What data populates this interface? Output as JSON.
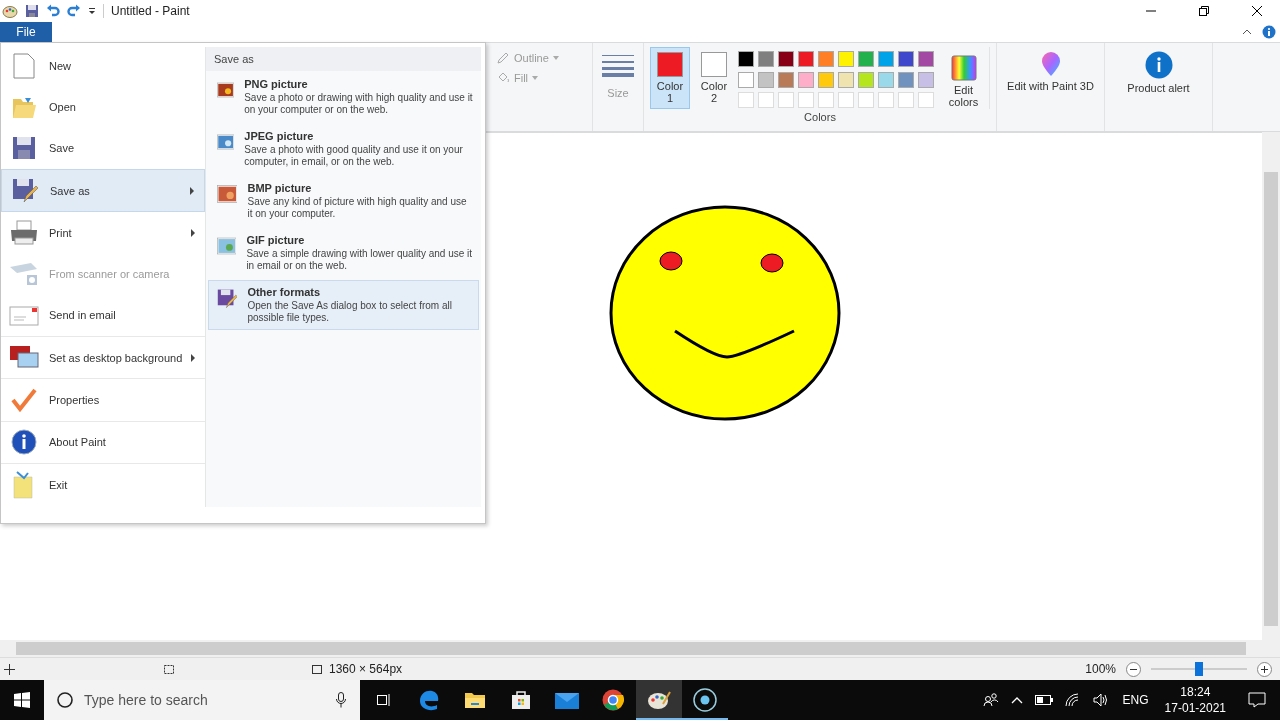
{
  "window": {
    "title": "Untitled - Paint"
  },
  "file_tab": {
    "label": "File",
    "selected": true
  },
  "file_menu": {
    "items": [
      {
        "label": "New",
        "disabled": false,
        "selected": false,
        "has_submenu": false
      },
      {
        "label": "Open",
        "disabled": false,
        "selected": false,
        "has_submenu": false
      },
      {
        "label": "Save",
        "disabled": false,
        "selected": false,
        "has_submenu": false
      },
      {
        "label": "Save as",
        "disabled": false,
        "selected": true,
        "has_submenu": true
      },
      {
        "label": "Print",
        "disabled": false,
        "selected": false,
        "has_submenu": true
      },
      {
        "label": "From scanner or camera",
        "disabled": true,
        "selected": false,
        "has_submenu": false
      },
      {
        "label": "Send in email",
        "disabled": false,
        "selected": false,
        "has_submenu": false
      },
      {
        "label": "Set as desktop background",
        "disabled": false,
        "selected": false,
        "has_submenu": true
      },
      {
        "label": "Properties",
        "disabled": false,
        "selected": false,
        "has_submenu": false
      },
      {
        "label": "About Paint",
        "disabled": false,
        "selected": false,
        "has_submenu": false
      },
      {
        "label": "Exit",
        "disabled": false,
        "selected": false,
        "has_submenu": false
      }
    ],
    "submenu": {
      "heading": "Save as",
      "options": [
        {
          "title": "PNG picture",
          "description": "Save a photo or drawing with high quality and use it on your computer or on the web.",
          "selected": false
        },
        {
          "title": "JPEG picture",
          "description": "Save a photo with good quality and use it on your computer, in email, or on the web.",
          "selected": false
        },
        {
          "title": "BMP picture",
          "description": "Save any kind of picture with high quality and use it on your computer.",
          "selected": false
        },
        {
          "title": "GIF picture",
          "description": "Save a simple drawing with lower quality and use it in email or on the web.",
          "selected": false
        },
        {
          "title": "Other formats",
          "description": "Open the Save As dialog box to select from all possible file types.",
          "selected": true
        }
      ]
    }
  },
  "ribbon": {
    "outline": "Outline",
    "fill": "Fill",
    "size": "Size",
    "color_slots": [
      {
        "label": "Color 1",
        "color": "#ed1c24",
        "selected": true
      },
      {
        "label": "Color 2",
        "color": "#ffffff",
        "selected": false
      }
    ],
    "palette": [
      {
        "color": "#000000"
      },
      {
        "color": "#7f7f7f"
      },
      {
        "color": "#880015"
      },
      {
        "color": "#ed1c24"
      },
      {
        "color": "#ff7f27"
      },
      {
        "color": "#fff200"
      },
      {
        "color": "#22b14c"
      },
      {
        "color": "#00a2e8"
      },
      {
        "color": "#3f48cc"
      },
      {
        "color": "#a349a4"
      },
      {
        "color": "#ffffff"
      },
      {
        "color": "#c3c3c3"
      },
      {
        "color": "#b97a57"
      },
      {
        "color": "#ffaec9"
      },
      {
        "color": "#ffc90e"
      },
      {
        "color": "#efe4b0"
      },
      {
        "color": "#b5e61d"
      },
      {
        "color": "#99d9ea"
      },
      {
        "color": "#7092be"
      },
      {
        "color": "#c8bfe7"
      }
    ],
    "colors_group": "Colors",
    "edit_colors": "Edit colors",
    "paint3d": "Edit with Paint 3D",
    "product_alert": "Product alert"
  },
  "status_bar": {
    "dimensions": "1360 × 564px",
    "zoom": "100%",
    "zoom_slider": {
      "level": 0.5
    }
  },
  "taskbar": {
    "search_placeholder": "Type here to search",
    "apps": [
      {
        "kind": "edge",
        "running": false,
        "selected": false
      },
      {
        "kind": "folder",
        "running": false,
        "selected": false
      },
      {
        "kind": "store",
        "running": false,
        "selected": false
      },
      {
        "kind": "mail",
        "running": false,
        "selected": false
      },
      {
        "kind": "chrome",
        "running": false,
        "selected": false
      },
      {
        "kind": "paint",
        "running": true,
        "selected": true
      },
      {
        "kind": "recorder",
        "running": true,
        "selected": false
      }
    ],
    "language": "ENG",
    "time": "18:24",
    "date": "17-01-2021"
  }
}
